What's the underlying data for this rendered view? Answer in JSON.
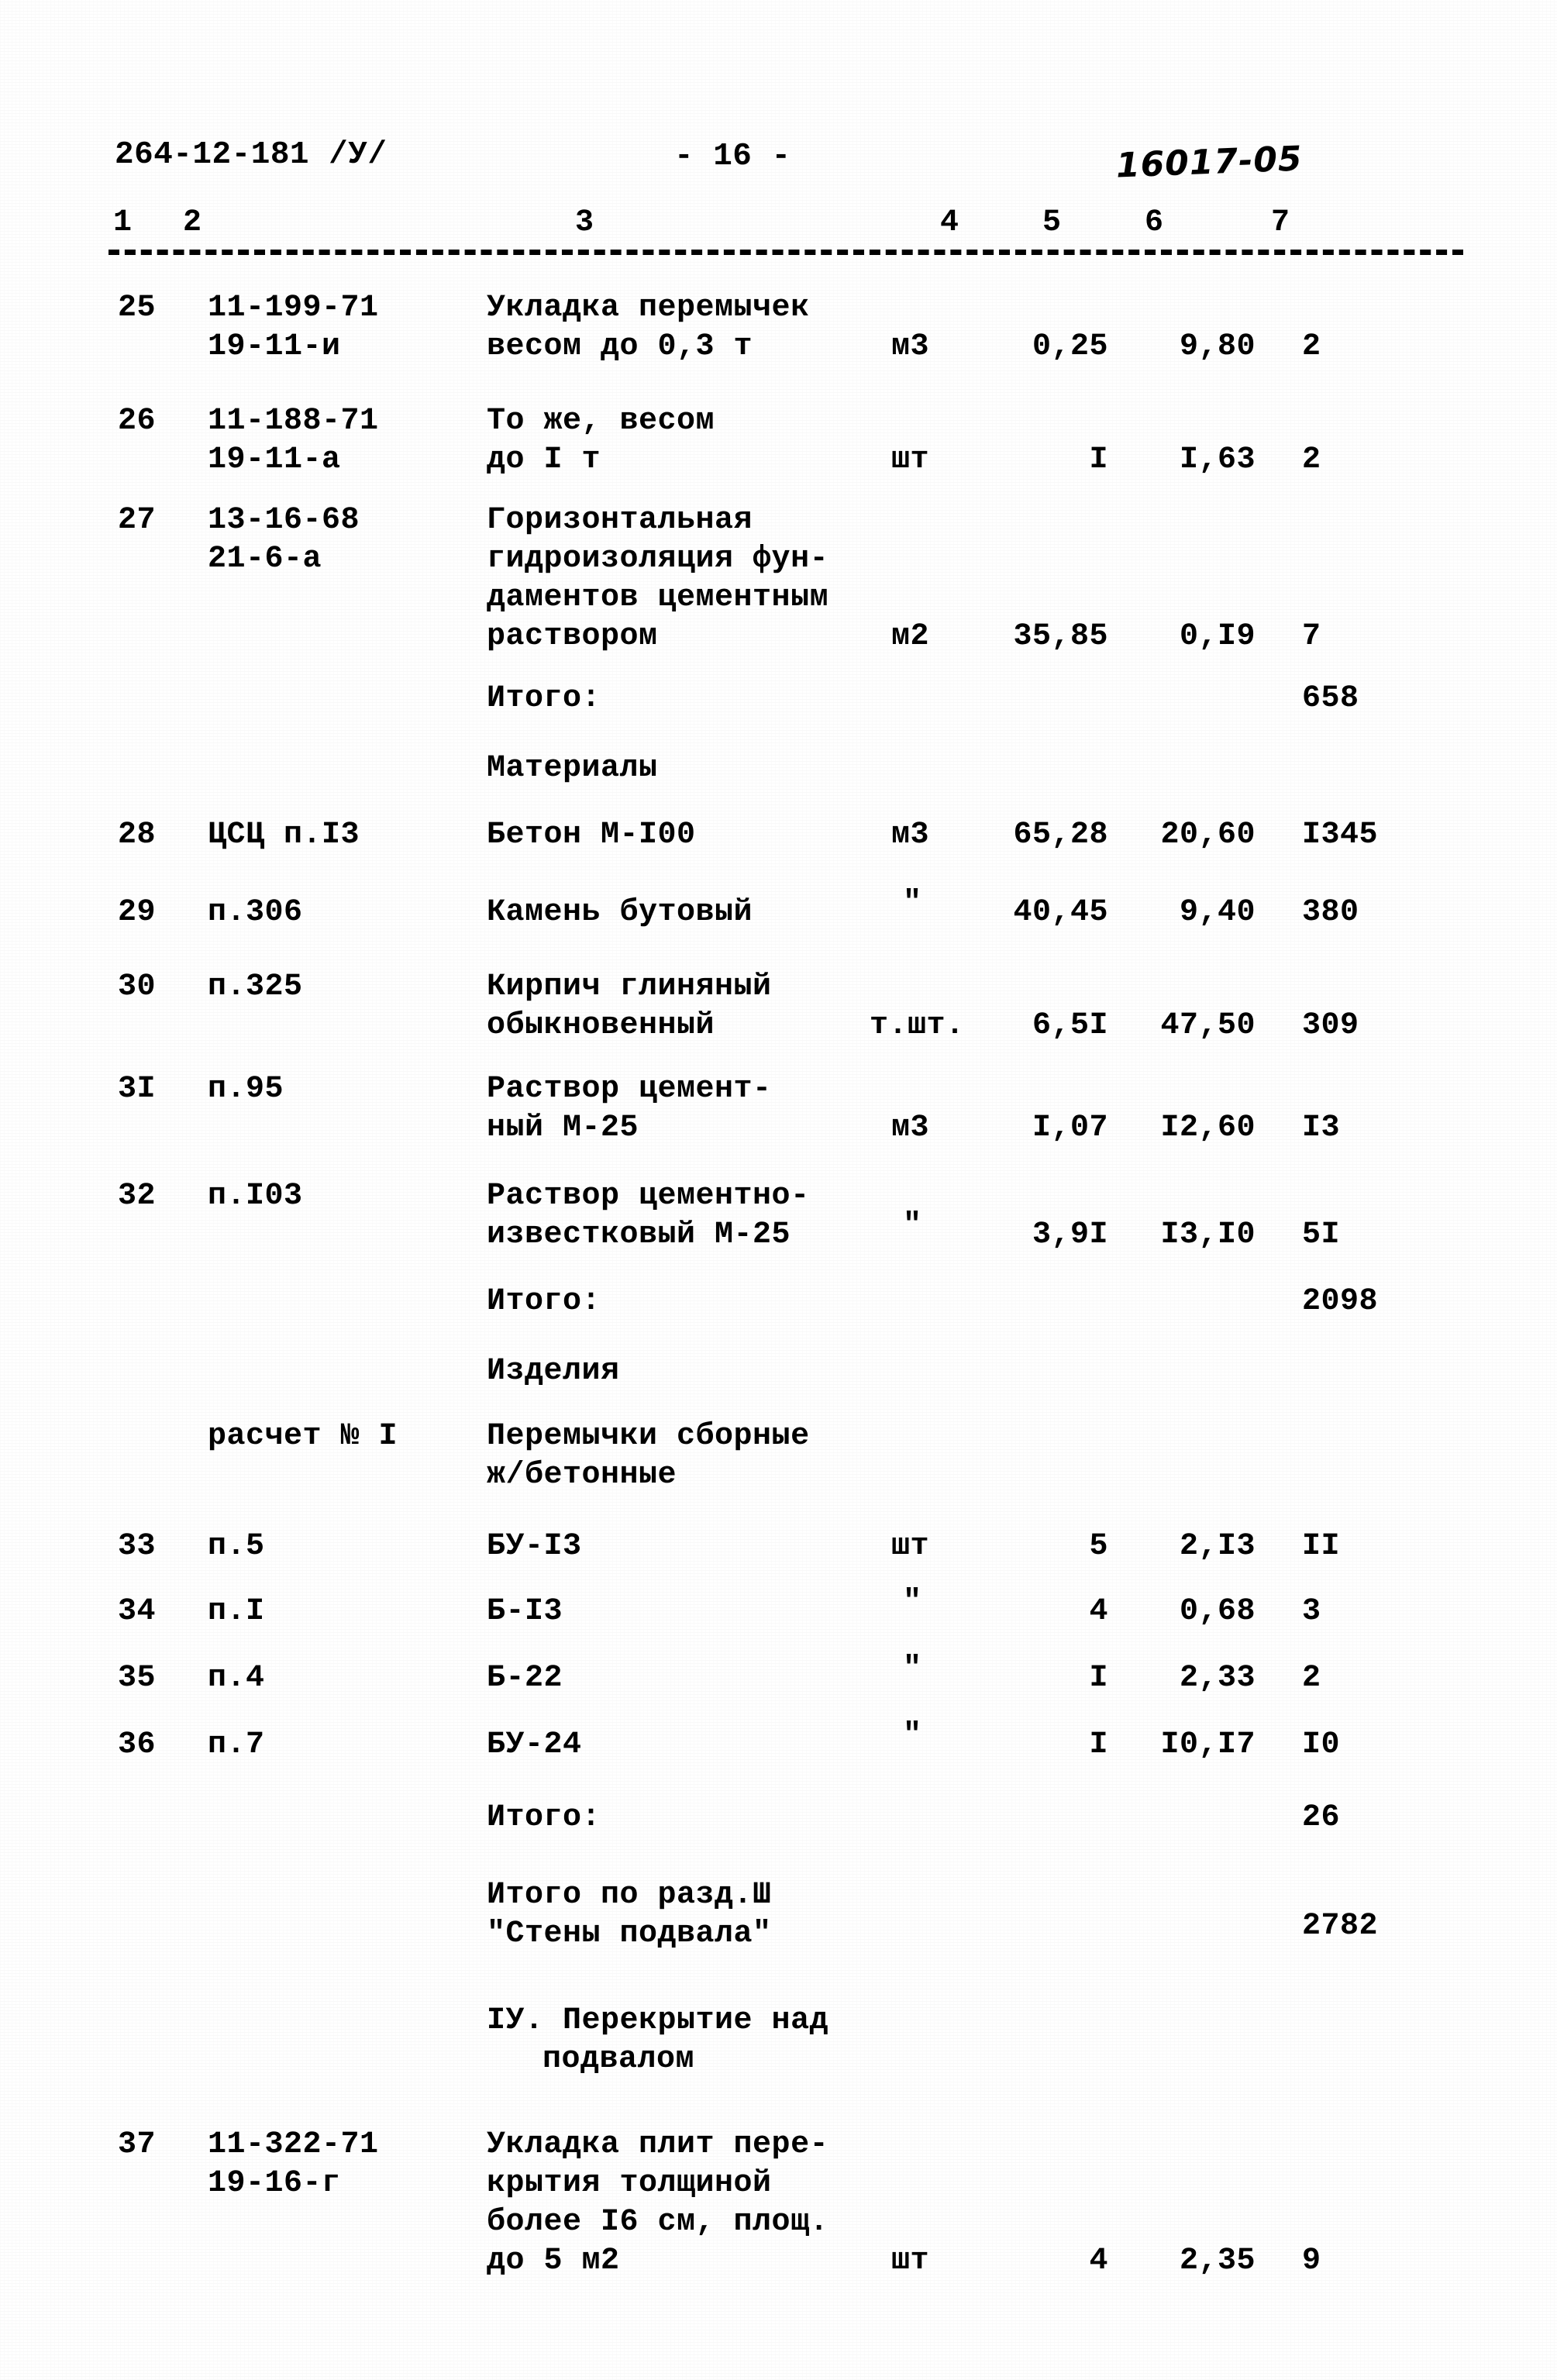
{
  "header": {
    "document_code": "264-12-181 /У/",
    "page_marker": "- 16 -",
    "handwritten_note": "16017-05"
  },
  "table": {
    "column_numbers": [
      "1",
      "2",
      "3",
      "4",
      "5",
      "6",
      "7"
    ],
    "rows": [
      {
        "num": "25",
        "code_lines": [
          "11-199-71",
          "19-11-и"
        ],
        "desc_lines": [
          "Укладка перемычек",
          "весом до 0,3 т"
        ],
        "unit": "м3",
        "qty": "0,25",
        "price": "9,80",
        "sum": "2"
      },
      {
        "num": "26",
        "code_lines": [
          "11-188-71",
          "19-11-а"
        ],
        "desc_lines": [
          "То же, весом",
          "до I т"
        ],
        "unit": "шт",
        "qty": "I",
        "price": "I,63",
        "sum": "2"
      },
      {
        "num": "27",
        "code_lines": [
          "13-16-68",
          "21-6-а"
        ],
        "desc_lines": [
          "Горизонтальная",
          "гидроизоляция фун-",
          "даментов цементным",
          "раствором"
        ],
        "unit": "м2",
        "qty": "35,85",
        "price": "0,I9",
        "sum": "7"
      }
    ],
    "subtotal_works": {
      "label": "Итого:",
      "sum": "658"
    },
    "materials_heading": "Материалы",
    "material_rows": [
      {
        "num": "28",
        "code_lines": [
          "ЦСЦ п.I3"
        ],
        "desc_lines": [
          "Бетон М-I00"
        ],
        "unit": "м3",
        "qty": "65,28",
        "price": "20,60",
        "sum": "I345"
      },
      {
        "num": "29",
        "code_lines": [
          "п.306"
        ],
        "desc_lines": [
          "Камень бутовый"
        ],
        "unit": "\"",
        "qty": "40,45",
        "price": "9,40",
        "sum": "380"
      },
      {
        "num": "30",
        "code_lines": [
          "п.325"
        ],
        "desc_lines": [
          "Кирпич глиняный",
          "обыкновенный"
        ],
        "unit": "т.шт.",
        "qty": "6,5I",
        "price": "47,50",
        "sum": "309"
      },
      {
        "num": "3I",
        "code_lines": [
          "п.95"
        ],
        "desc_lines": [
          "Раствор цемент-",
          "ный М-25"
        ],
        "unit": "м3",
        "qty": "I,07",
        "price": "I2,60",
        "sum": "I3"
      },
      {
        "num": "32",
        "code_lines": [
          "п.I03"
        ],
        "desc_lines": [
          "Раствор цементно-",
          "известковый М-25"
        ],
        "unit": "\"",
        "qty": "3,9I",
        "price": "I3,I0",
        "sum": "5I"
      }
    ],
    "subtotal_materials": {
      "label": "Итого:",
      "sum": "2098"
    },
    "products_heading": "Изделия",
    "calc_reference": {
      "code": "расчет № I",
      "desc_lines": [
        "Перемычки сборные",
        "ж/бетонные"
      ]
    },
    "product_rows": [
      {
        "num": "33",
        "code_lines": [
          "п.5"
        ],
        "desc_lines": [
          "БУ-I3"
        ],
        "unit": "шт",
        "qty": "5",
        "price": "2,I3",
        "sum": "II"
      },
      {
        "num": "34",
        "code_lines": [
          "п.I"
        ],
        "desc_lines": [
          "Б-I3"
        ],
        "unit": "\"",
        "qty": "4",
        "price": "0,68",
        "sum": "3"
      },
      {
        "num": "35",
        "code_lines": [
          "п.4"
        ],
        "desc_lines": [
          "Б-22"
        ],
        "unit": "\"",
        "qty": "I",
        "price": "2,33",
        "sum": "2"
      },
      {
        "num": "36",
        "code_lines": [
          "п.7"
        ],
        "desc_lines": [
          "БУ-24"
        ],
        "unit": "\"",
        "qty": "I",
        "price": "I0,I7",
        "sum": "I0"
      }
    ],
    "subtotal_products": {
      "label": "Итого:",
      "sum": "26"
    },
    "section_total": {
      "label_lines": [
        "Итого по разд.Ш",
        "\"Стены подвала\""
      ],
      "sum": "2782"
    },
    "next_section_heading": [
      "IУ. Перекрытие над",
      "подвалом"
    ],
    "next_section_rows": [
      {
        "num": "37",
        "code_lines": [
          "11-322-71",
          "19-16-г"
        ],
        "desc_lines": [
          "Укладка плит пере-",
          "крытия толщиной",
          "более I6 см, площ.",
          "до 5 м2"
        ],
        "unit": "шт",
        "qty": "4",
        "price": "2,35",
        "sum": "9"
      }
    ]
  }
}
